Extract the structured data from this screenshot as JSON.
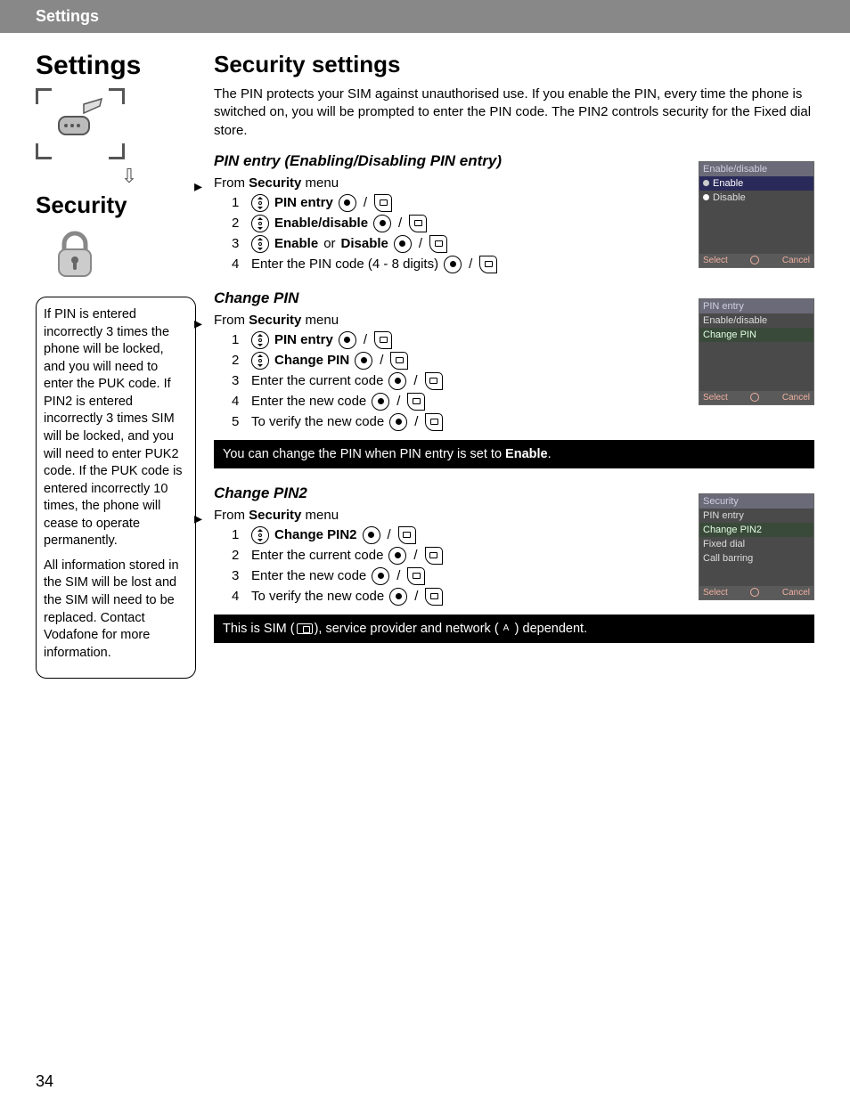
{
  "header": {
    "title": "Settings"
  },
  "sidebar": {
    "title": "Settings",
    "subtitle": "Security",
    "note_p1": "If PIN is entered incorrectly 3 times the phone will be locked, and you will need to enter the PUK code. If PIN2 is entered incorrectly 3 times SIM will be locked, and you will need to enter PUK2 code. If the PUK code is entered incorrectly 10 times, the phone will cease to operate permanently.",
    "note_p2": "All information stored in the SIM will be lost and the SIM will need to be replaced. Contact Vodafone for more information."
  },
  "main": {
    "title": "Security settings",
    "intro": "The PIN protects your SIM against unauthorised use. If you enable the PIN, every time the phone is switched on, you will be prompted to enter the PIN code. The PIN2 controls security for the Fixed dial store."
  },
  "sections": {
    "pin_entry": {
      "heading": "PIN entry (Enabling/Disabling PIN entry)",
      "from_prefix": "From ",
      "from_bold": "Security",
      "from_suffix": " menu",
      "steps": [
        {
          "num": "1",
          "nav": true,
          "label_bold": "PIN entry",
          "dot": true,
          "softkey": true
        },
        {
          "num": "2",
          "nav": true,
          "label_bold": "Enable/disable",
          "dot": true,
          "softkey": true
        },
        {
          "num": "3",
          "nav": true,
          "label_bold": "Enable",
          "mid_text": " or ",
          "label_bold2": "Disable",
          "dot": true,
          "softkey": true
        },
        {
          "num": "4",
          "nav": false,
          "plain_text": "Enter the PIN code (4 - 8 digits)",
          "dot": true,
          "softkey": true
        }
      ],
      "screenshot": {
        "title": "Enable/disable",
        "rows": [
          {
            "label": "Enable",
            "bullet": "empty",
            "selected": true
          },
          {
            "label": "Disable",
            "bullet": "filled",
            "selected": false
          }
        ],
        "softkeys": {
          "left": "Select",
          "right": "Cancel"
        }
      }
    },
    "change_pin": {
      "heading": "Change PIN",
      "from_prefix": "From ",
      "from_bold": "Security",
      "from_suffix": " menu",
      "steps": [
        {
          "num": "1",
          "nav": true,
          "label_bold": "PIN entry",
          "dot": true,
          "softkey": true
        },
        {
          "num": "2",
          "nav": true,
          "label_bold": "Change PIN",
          "dot": true,
          "softkey": true
        },
        {
          "num": "3",
          "nav": false,
          "plain_text": "Enter the current code",
          "dot": true,
          "softkey": true
        },
        {
          "num": "4",
          "nav": false,
          "plain_text": "Enter the new code",
          "dot": true,
          "softkey": true
        },
        {
          "num": "5",
          "nav": false,
          "plain_text": "To verify the new code",
          "dot": true,
          "softkey": true
        }
      ],
      "screenshot": {
        "title": "PIN entry",
        "rows": [
          {
            "label": "Enable/disable",
            "selected": false
          },
          {
            "label": "Change PIN",
            "selected": true,
            "hilite": true
          }
        ],
        "softkeys": {
          "left": "Select",
          "right": "Cancel"
        }
      },
      "info": {
        "prefix": "You can change the PIN when PIN entry is set to ",
        "bold": "Enable",
        "suffix": "."
      }
    },
    "change_pin2": {
      "heading": "Change PIN2",
      "from_prefix": "From ",
      "from_bold": "Security",
      "from_suffix": " menu",
      "steps": [
        {
          "num": "1",
          "nav": true,
          "label_bold": "Change PIN2",
          "dot": true,
          "softkey": true
        },
        {
          "num": "2",
          "nav": false,
          "plain_text": "Enter the current code",
          "dot": true,
          "softkey": true
        },
        {
          "num": "3",
          "nav": false,
          "plain_text": "Enter the new code",
          "dot": true,
          "softkey": true
        },
        {
          "num": "4",
          "nav": false,
          "plain_text": "To verify the new code",
          "dot": true,
          "softkey": true
        }
      ],
      "screenshot": {
        "title": "Security",
        "rows": [
          {
            "label": "PIN entry",
            "selected": false
          },
          {
            "label": "Change PIN2",
            "selected": true,
            "hilite": true
          },
          {
            "label": "Fixed dial",
            "selected": false
          },
          {
            "label": "Call barring",
            "selected": false
          }
        ],
        "softkeys": {
          "left": "Select",
          "right": "Cancel"
        }
      },
      "info": {
        "prefix": "This is SIM (",
        "mid": "), service provider and network (",
        "suffix": ") dependent."
      }
    }
  },
  "page_number": "34"
}
